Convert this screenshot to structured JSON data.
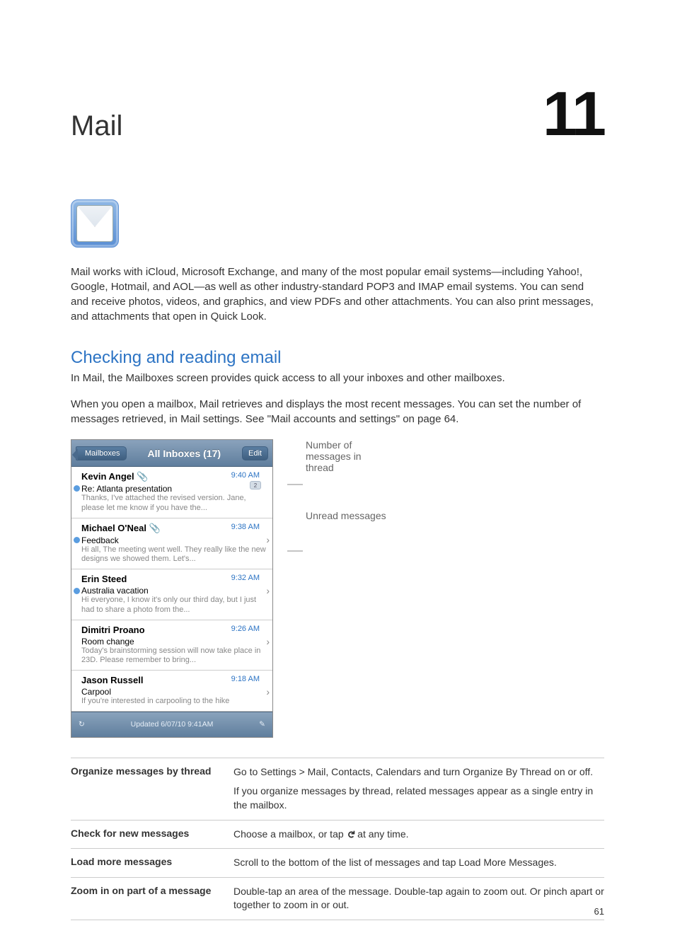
{
  "header": {
    "title": "Mail",
    "chapter_number": "11"
  },
  "intro_text": "Mail works with iCloud, Microsoft Exchange, and many of the most popular email systems—including Yahoo!, Google, Hotmail, and AOL—as well as other industry-standard POP3 and IMAP email systems. You can send and receive photos, videos, and graphics, and view PDFs and other attachments. You can also print messages, and attachments that open in Quick Look.",
  "section_heading": "Checking and reading email",
  "section_sub": "In Mail, the Mailboxes screen provides quick access to all your inboxes and other mailboxes.",
  "section_para": "When you open a mailbox, Mail retrieves and displays the most recent messages. You can set the number of messages retrieved, in Mail settings. See \"Mail accounts and settings\" on page 64.",
  "nav": {
    "back_label": "Mailboxes",
    "title": "All Inboxes (17)",
    "edit_label": "Edit"
  },
  "messages": [
    {
      "sender": "Kevin Angel",
      "has_clip": true,
      "time": "9:40 AM",
      "subject": "Re: Atlanta presentation",
      "preview": "Thanks, I've attached the revised version. Jane, please let me know if you have the...",
      "unread": true,
      "thread_count": "2"
    },
    {
      "sender": "Michael O'Neal",
      "has_clip": true,
      "time": "9:38 AM",
      "subject": "Feedback",
      "preview": "Hi all, The meeting went well. They really like the new designs we showed them. Let's...",
      "unread": true
    },
    {
      "sender": "Erin Steed",
      "has_clip": false,
      "time": "9:32 AM",
      "subject": "Australia vacation",
      "preview": "Hi everyone, I know it's only our third day, but I just had to share a photo from the...",
      "unread": true
    },
    {
      "sender": "Dimitri Proano",
      "has_clip": false,
      "time": "9:26 AM",
      "subject": "Room change",
      "preview": "Today's brainstorming session will now take place in 23D. Please remember to bring...",
      "unread": false
    },
    {
      "sender": "Jason Russell",
      "has_clip": false,
      "time": "9:18 AM",
      "subject": "Carpool",
      "preview": "If you're interested in carpooling to the hike",
      "unread": false
    }
  ],
  "toolbar_status": "Updated 6/07/10 9:41AM",
  "callouts": {
    "thread_a": "Number of",
    "thread_b": "messages in",
    "thread_c": "thread",
    "unread": "Unread messages"
  },
  "tips": [
    {
      "label": "Organize messages by thread",
      "body_lines": [
        "Go to Settings > Mail, Contacts, Calendars and turn Organize By Thread on or off.",
        "If you organize messages by thread, related messages appear as a single entry in the mailbox."
      ]
    },
    {
      "label": "Check for new messages",
      "body_lines": [
        "Choose a mailbox, or tap ↻ at any time."
      ]
    },
    {
      "label": "Load more messages",
      "body_lines": [
        "Scroll to the bottom of the list of messages and tap Load More Messages."
      ]
    },
    {
      "label": "Zoom in on part of a message",
      "body_lines": [
        "Double-tap an area of the message. Double-tap again to zoom out. Or pinch apart or together to zoom in or out."
      ]
    }
  ],
  "page_number": "61",
  "icons": {
    "clip": "📎",
    "refresh": "↻",
    "compose": "✎",
    "chevron": "›"
  }
}
